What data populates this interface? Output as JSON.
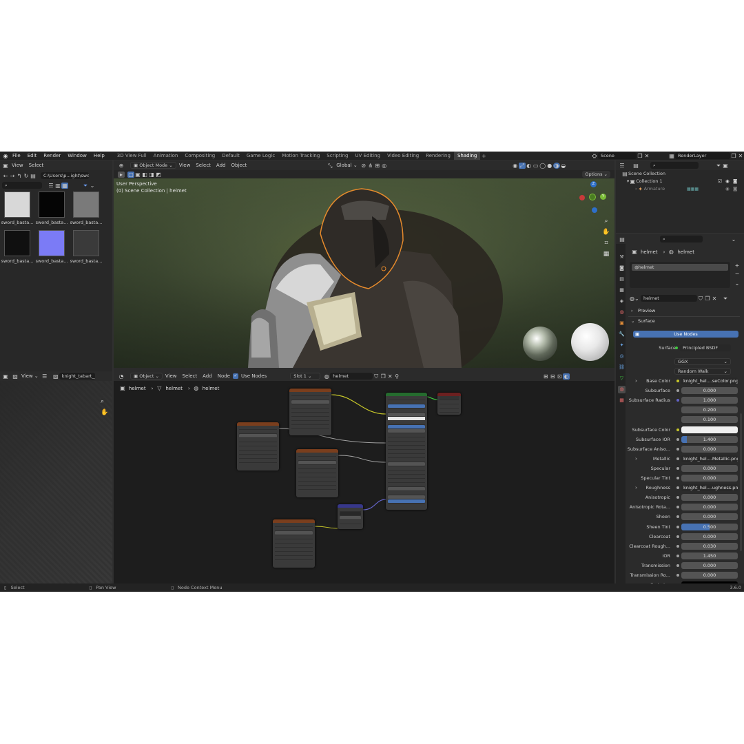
{
  "menus": [
    "File",
    "Edit",
    "Render",
    "Window",
    "Help"
  ],
  "workspaces": [
    "3D View Full",
    "Animation",
    "Compositing",
    "Default",
    "Game Logic",
    "Motion Tracking",
    "Scripting",
    "UV Editing",
    "Video Editing",
    "Rendering",
    "Shading"
  ],
  "active_workspace": "Shading",
  "scene_name": "Scene",
  "render_layer": "RenderLayer",
  "file_browser": {
    "menu": [
      "View",
      "Select"
    ],
    "path": "C:\\Users\\p...ight\\sword\\",
    "thumbnails": [
      {
        "label": "sword_basta...",
        "color": "#d8d8d8"
      },
      {
        "label": "sword_basta...",
        "color": "#050505"
      },
      {
        "label": "sword_basta...",
        "color": "#7a7a7a"
      },
      {
        "label": "sword_basta...",
        "color": "#101010"
      },
      {
        "label": "sword_basta...",
        "color": "#7b7bf6"
      },
      {
        "label": "sword_basta...",
        "color": "#3a3a3a"
      }
    ]
  },
  "viewport": {
    "mode": "Object Mode",
    "menu": [
      "View",
      "Select",
      "Add",
      "Object"
    ],
    "orientation": "Global",
    "perspective": "User Perspective",
    "collection_info": "(0) Scene Collection | helmet",
    "options": "Options"
  },
  "image_editor": {
    "menu": "View",
    "image_name": "knight_tabart__tabar"
  },
  "node_editor": {
    "mode": "Object",
    "menu": [
      "View",
      "Select",
      "Add",
      "Node"
    ],
    "use_nodes": "Use Nodes",
    "slot": "Slot 1",
    "material": "helmet",
    "breadcrumb": [
      "helmet",
      "helmet",
      "helmet"
    ]
  },
  "outliner": {
    "scene_collection": "Scene Collection",
    "collection": "Collection 1",
    "armature": "Armature"
  },
  "properties": {
    "breadcrumb": [
      "helmet",
      "helmet"
    ],
    "slot_item": "helmet",
    "material": "helmet",
    "preview": "Preview",
    "surface_header": "Surface",
    "use_nodes": "Use Nodes",
    "surface_label": "Surface",
    "surface_value": "Principled BSDF",
    "distribution": "GGX",
    "subsurface_method": "Random Walk",
    "rows": [
      {
        "label": "Base Color",
        "value": "knight_hel....seColor.png",
        "dot": "#c7c729",
        "link": true
      },
      {
        "label": "Subsurface",
        "value": "0.000",
        "dot": "#a1a1a1"
      },
      {
        "label": "Subsurface Radius",
        "value": "1.000",
        "dot": "#6363c7"
      },
      {
        "label": "",
        "value": "0.200"
      },
      {
        "label": "",
        "value": "0.100"
      },
      {
        "label": "Subsurface Color",
        "value": "",
        "dot": "#c7c729",
        "swatch": "#f0f0f0"
      },
      {
        "label": "Subsurface IOR",
        "value": "1.400",
        "dot": "#a1a1a1",
        "fill": 0.1
      },
      {
        "label": "Subsurface Aniso...",
        "value": "0.000",
        "dot": "#a1a1a1"
      },
      {
        "label": "Metallic",
        "value": "knight_hel....Metallic.png",
        "dot": "#a1a1a1",
        "link": true
      },
      {
        "label": "Specular",
        "value": "0.000",
        "dot": "#a1a1a1"
      },
      {
        "label": "Specular Tint",
        "value": "0.000",
        "dot": "#a1a1a1"
      },
      {
        "label": "Roughness",
        "value": "knight_hel....ughness.png",
        "dot": "#a1a1a1",
        "link": true
      },
      {
        "label": "Anisotropic",
        "value": "0.000",
        "dot": "#a1a1a1"
      },
      {
        "label": "Anisotropic Rota...",
        "value": "0.000",
        "dot": "#a1a1a1"
      },
      {
        "label": "Sheen",
        "value": "0.000",
        "dot": "#a1a1a1"
      },
      {
        "label": "Sheen Tint",
        "value": "0.500",
        "dot": "#a1a1a1",
        "fill": 0.5
      },
      {
        "label": "Clearcoat",
        "value": "0.000",
        "dot": "#a1a1a1"
      },
      {
        "label": "Clearcoat Rough...",
        "value": "0.030",
        "dot": "#a1a1a1"
      },
      {
        "label": "IOR",
        "value": "1.450",
        "dot": "#a1a1a1"
      },
      {
        "label": "Transmission",
        "value": "0.000",
        "dot": "#a1a1a1"
      },
      {
        "label": "Transmission Ro...",
        "value": "0.000",
        "dot": "#a1a1a1"
      },
      {
        "label": "Emission",
        "value": "",
        "dot": "#c7c729",
        "swatch": "#000000"
      }
    ]
  },
  "status_bar": {
    "select": "Select",
    "pan": "Pan View",
    "context": "Node Context Menu",
    "version": "3.6.0"
  },
  "colors": {
    "accent": "#4772b3",
    "selection_orange": "#e58a2c",
    "image_node_header": "#7a3e1d",
    "bsdf_header": "#256b2e",
    "output_header": "#6b2020",
    "normal_map_header": "#37378a"
  }
}
